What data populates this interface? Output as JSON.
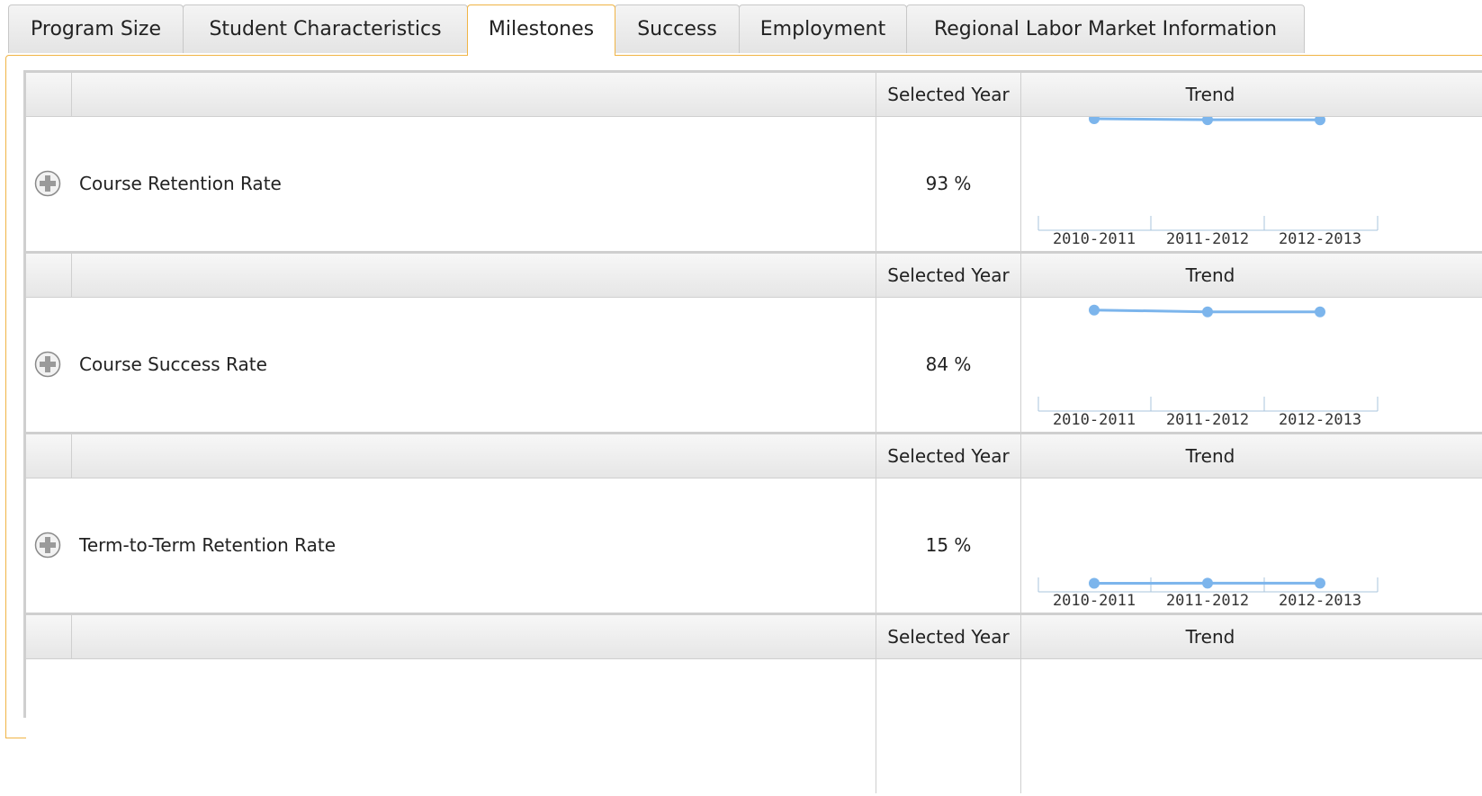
{
  "tabs": [
    {
      "label": "Program Size",
      "active": false
    },
    {
      "label": "Student Characteristics",
      "active": false
    },
    {
      "label": "Milestones",
      "active": true
    },
    {
      "label": "Success",
      "active": false
    },
    {
      "label": "Employment",
      "active": false
    },
    {
      "label": "Regional Labor Market Information",
      "active": false
    }
  ],
  "colors": {
    "accent": "#f0b445",
    "trend_line": "#7cb5ec",
    "border": "#cfcfcf"
  },
  "table": {
    "header": {
      "selected_year": "Selected Year",
      "trend": "Trend"
    },
    "rows": [
      {
        "metric": "Course Retention Rate",
        "selected_value": "93 %",
        "expand_icon": "plus-circle-icon"
      },
      {
        "metric": "Course Success Rate",
        "selected_value": "84 %",
        "expand_icon": "plus-circle-icon"
      },
      {
        "metric": "Term-to-Term Retention Rate",
        "selected_value": "15 %",
        "expand_icon": "plus-circle-icon"
      }
    ]
  },
  "chart_data": [
    {
      "type": "line",
      "categories": [
        "2010-2011",
        "2011-2012",
        "2012-2013"
      ],
      "series": [
        {
          "values": [
            93.6,
            92.9,
            92.8
          ]
        }
      ]
    },
    {
      "type": "line",
      "categories": [
        "2010-2011",
        "2011-2012",
        "2012-2013"
      ],
      "series": [
        {
          "values": [
            85.6,
            84.2,
            84.1
          ]
        }
      ]
    },
    {
      "type": "line",
      "categories": [
        "2010-2011",
        "2011-2012",
        "2012-2013"
      ],
      "series": [
        {
          "values": [
            14.8,
            14.9,
            14.9
          ]
        }
      ]
    }
  ]
}
